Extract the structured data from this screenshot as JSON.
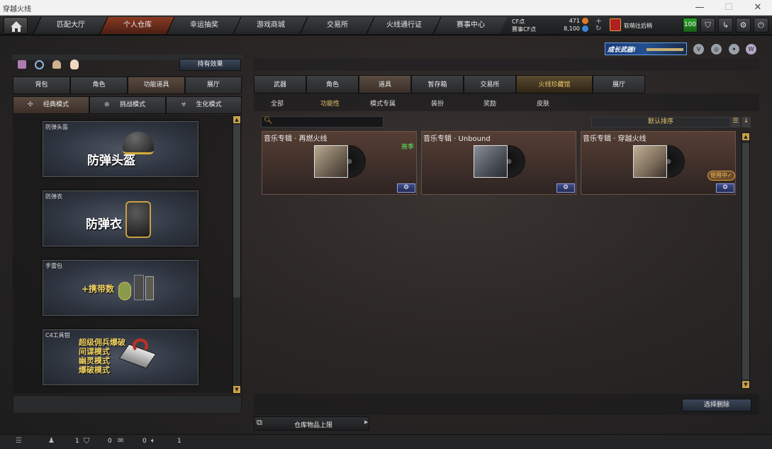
{
  "window": {
    "title": "穿越火线",
    "minimize": "—",
    "maximize": "☐",
    "close": "✕"
  },
  "nav": {
    "tabs": [
      "匹配大厅",
      "个人仓库",
      "幸运抽奖",
      "游戏商城",
      "交易所",
      "火线通行证",
      "赛事中心"
    ],
    "active_index": 1
  },
  "currency": {
    "cf_label": "CF点",
    "cf_value": "471",
    "match_cf_label": "赛事CF点",
    "match_cf_value": "8,100",
    "plus": "+",
    "refresh": "↻"
  },
  "user": {
    "name": "软萌往后稍",
    "level": "100"
  },
  "banner": {
    "text": "成长武器!"
  },
  "left": {
    "effect_button": "持有效果",
    "tabs": [
      "背包",
      "角色",
      "功能道具",
      "展厅"
    ],
    "active_tab": 2,
    "modes": [
      "经典模式",
      "挑战模式",
      "生化模式"
    ],
    "active_mode": 0,
    "cards": [
      {
        "caption": "防弹头盔",
        "title": "防弹头盔"
      },
      {
        "caption": "防弹衣",
        "title": "防弹衣"
      },
      {
        "caption": "手雷包",
        "title": "+携带数"
      },
      {
        "caption": "C4工具钳",
        "lines": [
          "超级佣兵爆破",
          "间谍模式",
          "幽灵模式",
          "爆破模式"
        ]
      }
    ]
  },
  "right": {
    "tabs": [
      "武器",
      "角色",
      "道具",
      "暂存箱",
      "交易所",
      "火线珍藏馆",
      "展厅"
    ],
    "active_tab": 2,
    "subtabs": [
      "全部",
      "功能性",
      "模式专属",
      "装扮",
      "奖励",
      "皮肤"
    ],
    "active_subtab": 1,
    "search_placeholder": "",
    "sort_label": "默认排序",
    "items": [
      {
        "name": "音乐专辑 · 再燃火线",
        "badge": "赛季"
      },
      {
        "name": "音乐专辑 · Unbound",
        "badge": ""
      },
      {
        "name": "音乐专辑 · 穿越火线",
        "badge": "使用中✓"
      }
    ],
    "delete_button": "选择删除",
    "capacity_label": "仓库物品上限"
  },
  "statusbar": {
    "count1": "1",
    "count2": "0",
    "count3": "0",
    "count4": "1"
  }
}
